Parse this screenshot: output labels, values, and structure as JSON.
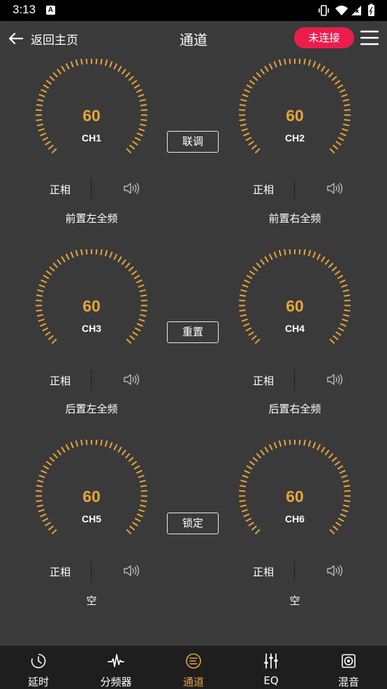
{
  "status_bar": {
    "time": "3:13",
    "badge": "A"
  },
  "header": {
    "back_label": "返回主页",
    "title": "通道",
    "connection": "未连接"
  },
  "colors": {
    "accent": "#e7a43c",
    "disconnected": "#ea1d4d",
    "background": "#3a3a3a"
  },
  "channels": [
    {
      "value": "60",
      "label": "CH1",
      "phase": "正相",
      "name": "前置左全频"
    },
    {
      "value": "60",
      "label": "CH2",
      "phase": "正相",
      "name": "前置右全频"
    },
    {
      "value": "60",
      "label": "CH3",
      "phase": "正相",
      "name": "后置左全频"
    },
    {
      "value": "60",
      "label": "CH4",
      "phase": "正相",
      "name": "后置右全频"
    },
    {
      "value": "60",
      "label": "CH5",
      "phase": "正相",
      "name": "空"
    },
    {
      "value": "60",
      "label": "CH6",
      "phase": "正相",
      "name": "空"
    }
  ],
  "actions": {
    "link": "联调",
    "reset": "重置",
    "lock": "锁定"
  },
  "nav": [
    {
      "label": "延时",
      "icon": "clock-icon"
    },
    {
      "label": "分频器",
      "icon": "waveform-icon"
    },
    {
      "label": "通道",
      "icon": "channel-icon",
      "active": true
    },
    {
      "label": "EQ",
      "icon": "sliders-icon"
    },
    {
      "label": "混音",
      "icon": "speaker-mix-icon"
    }
  ]
}
